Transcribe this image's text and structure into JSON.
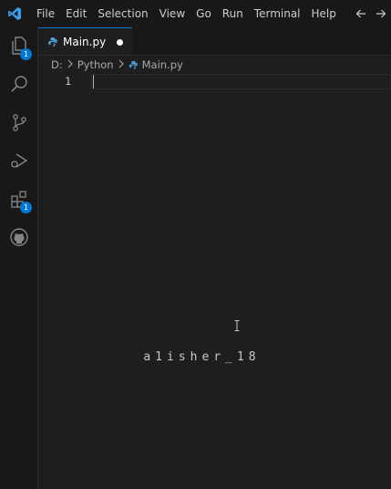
{
  "app": {
    "logo_icon": "vscode-logo-icon",
    "accent": "#0078d4"
  },
  "menu": {
    "items": [
      {
        "label": "File"
      },
      {
        "label": "Edit"
      },
      {
        "label": "Selection"
      },
      {
        "label": "View"
      },
      {
        "label": "Go"
      },
      {
        "label": "Run"
      },
      {
        "label": "Terminal"
      },
      {
        "label": "Help"
      }
    ],
    "back_icon": "arrow-left-icon",
    "forward_icon": "arrow-right-icon"
  },
  "activity_bar": {
    "items": [
      {
        "icon": "explorer-icon",
        "badge": "1"
      },
      {
        "icon": "search-icon"
      },
      {
        "icon": "source-control-icon"
      },
      {
        "icon": "run-debug-icon"
      },
      {
        "icon": "extensions-icon",
        "badge": "1"
      },
      {
        "icon": "github-icon"
      }
    ]
  },
  "tabs": [
    {
      "label": "Main.py",
      "icon": "python-file-icon",
      "dirty": true
    }
  ],
  "breadcrumb": {
    "segments": [
      "D:",
      "Python",
      "Main.py"
    ]
  },
  "editor": {
    "lines": [
      {
        "number": "1",
        "text": ""
      }
    ]
  },
  "watermark": "a1isher_18"
}
